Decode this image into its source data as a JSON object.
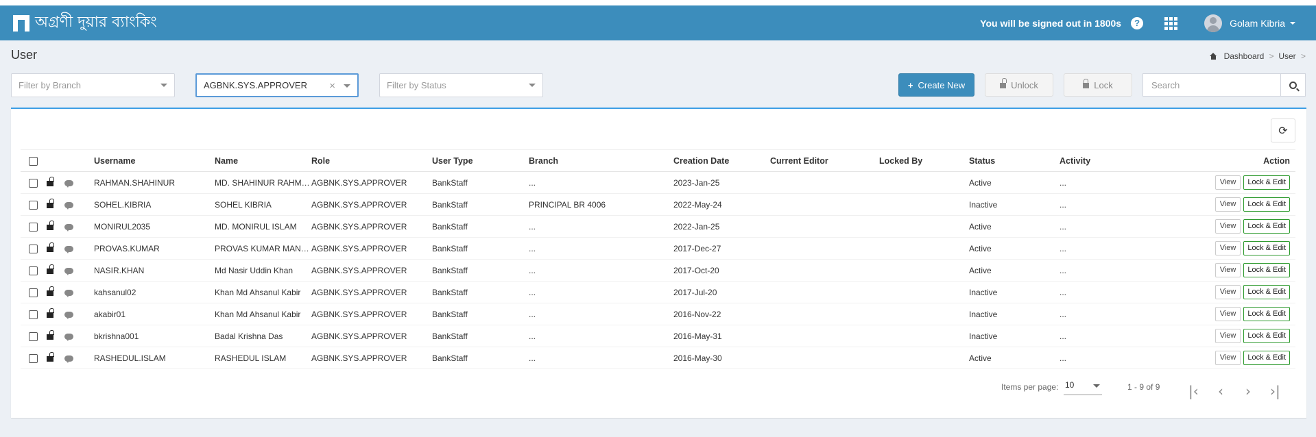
{
  "header": {
    "brand": "অগ্রণী দুয়ার ব্যাংকিং",
    "signout_text": "You will be signed out in 1800s",
    "help_icon": "?",
    "user_name": "Golam Kibria"
  },
  "page": {
    "title": "User",
    "breadcrumb": [
      "Dashboard",
      "User"
    ]
  },
  "filters": {
    "branch_placeholder": "Filter by Branch",
    "role_value": "AGBNK.SYS.APPROVER",
    "status_placeholder": "Filter by Status"
  },
  "toolbar": {
    "create_label": "Create New",
    "unlock_label": "Unlock",
    "lock_label": "Lock",
    "search_placeholder": "Search"
  },
  "table": {
    "columns": [
      "Username",
      "Name",
      "Role",
      "User Type",
      "Branch",
      "Creation Date",
      "Current Editor",
      "Locked By",
      "Status",
      "Activity",
      "Action"
    ],
    "rows": [
      {
        "username": "RAHMAN.SHAHINUR",
        "name": "MD. SHAHINUR RAHMAN",
        "role": "AGBNK.SYS.APPROVER",
        "type": "BankStaff",
        "branch": "...",
        "created": "2023-Jan-25",
        "editor": "",
        "locked_by": "",
        "status": "Active",
        "activity": "..."
      },
      {
        "username": "SOHEL.KIBRIA",
        "name": "SOHEL KIBRIA",
        "role": "AGBNK.SYS.APPROVER",
        "type": "BankStaff",
        "branch": "PRINCIPAL BR 4006",
        "created": "2022-May-24",
        "editor": "",
        "locked_by": "",
        "status": "Inactive",
        "activity": "..."
      },
      {
        "username": "MONIRUL2035",
        "name": "MD. MONIRUL ISLAM",
        "role": "AGBNK.SYS.APPROVER",
        "type": "BankStaff",
        "branch": "...",
        "created": "2022-Jan-25",
        "editor": "",
        "locked_by": "",
        "status": "Active",
        "activity": "..."
      },
      {
        "username": "PROVAS.KUMAR",
        "name": "PROVAS KUMAR MANDAL",
        "role": "AGBNK.SYS.APPROVER",
        "type": "BankStaff",
        "branch": "...",
        "created": "2017-Dec-27",
        "editor": "",
        "locked_by": "",
        "status": "Active",
        "activity": "..."
      },
      {
        "username": "NASIR.KHAN",
        "name": "Md Nasir Uddin Khan",
        "role": "AGBNK.SYS.APPROVER",
        "type": "BankStaff",
        "branch": "...",
        "created": "2017-Oct-20",
        "editor": "",
        "locked_by": "",
        "status": "Active",
        "activity": "..."
      },
      {
        "username": "kahsanul02",
        "name": "Khan Md Ahsanul Kabir",
        "role": "AGBNK.SYS.APPROVER",
        "type": "BankStaff",
        "branch": "...",
        "created": "2017-Jul-20",
        "editor": "",
        "locked_by": "",
        "status": "Inactive",
        "activity": "..."
      },
      {
        "username": "akabir01",
        "name": "Khan Md Ahsanul Kabir",
        "role": "AGBNK.SYS.APPROVER",
        "type": "BankStaff",
        "branch": "...",
        "created": "2016-Nov-22",
        "editor": "",
        "locked_by": "",
        "status": "Inactive",
        "activity": "..."
      },
      {
        "username": "bkrishna001",
        "name": "Badal Krishna Das",
        "role": "AGBNK.SYS.APPROVER",
        "type": "BankStaff",
        "branch": "...",
        "created": "2016-May-31",
        "editor": "",
        "locked_by": "",
        "status": "Inactive",
        "activity": "..."
      },
      {
        "username": "RASHEDUL.ISLAM",
        "name": "RASHEDUL ISLAM",
        "role": "AGBNK.SYS.APPROVER",
        "type": "BankStaff",
        "branch": "...",
        "created": "2016-May-30",
        "editor": "",
        "locked_by": "",
        "status": "Active",
        "activity": "..."
      }
    ],
    "view_label": "View",
    "lock_edit_label": "Lock & Edit"
  },
  "pagination": {
    "items_per_page_label": "Items per page:",
    "items_per_page": "10",
    "range": "1 - 9 of 9"
  },
  "colors": {
    "navbar": "#3c8dbc",
    "primary_button": "#3c8dbc",
    "box_border": "#3c9ee5",
    "lock_edit_border": "#2e9a2e"
  }
}
